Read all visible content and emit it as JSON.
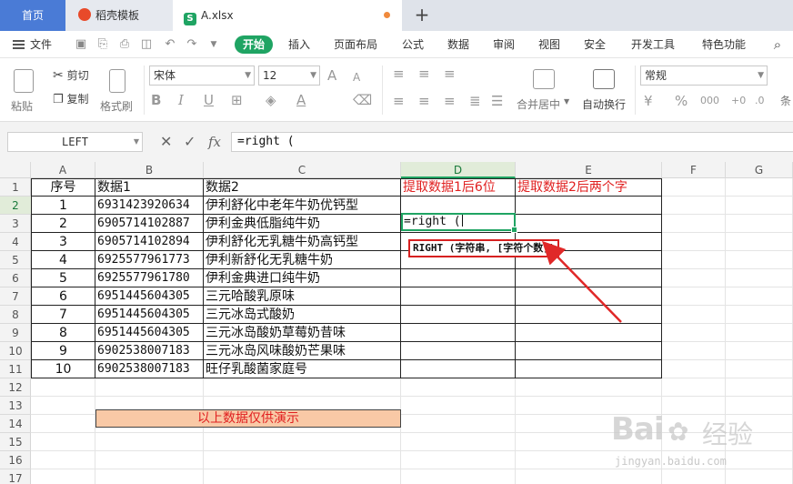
{
  "tabs": {
    "home": "首页",
    "templates": "稻壳模板",
    "file_icon": "S",
    "file": "A.xlsx",
    "add": "+"
  },
  "menu": {
    "file": "文件",
    "start": "开始",
    "items": [
      "插入",
      "页面布局",
      "公式",
      "数据",
      "审阅",
      "视图",
      "安全",
      "开发工具",
      "特色功能"
    ]
  },
  "ribbon": {
    "paste": "粘贴",
    "cut": "剪切",
    "copy": "复制",
    "format_painter": "格式刷",
    "font_name": "宋体",
    "font_size": "12",
    "bold": "B",
    "italic": "I",
    "underline": "U",
    "grow_font": "A",
    "shrink_font": "A",
    "merge_center": "合并居中",
    "wrap_text": "自动换行",
    "number_format": "常规",
    "percent": "%",
    "more": "条"
  },
  "formula_bar": {
    "name_box": "LEFT",
    "cancel": "✕",
    "confirm": "✓",
    "fx": "fx",
    "formula": "=right ("
  },
  "columns": [
    "A",
    "B",
    "C",
    "D",
    "E",
    "F",
    "G"
  ],
  "rows": [
    "1",
    "2",
    "3",
    "4",
    "5",
    "6",
    "7",
    "8",
    "9",
    "10",
    "11",
    "12",
    "13",
    "14",
    "15",
    "16",
    "17"
  ],
  "header_row": {
    "a": "序号",
    "b": "数据1",
    "c": "数据2",
    "d": "提取数据1后6位",
    "e": "提取数据2后两个字"
  },
  "table": [
    {
      "seq": "1",
      "code": "6931423920634",
      "name": "伊利舒化中老年牛奶优钙型"
    },
    {
      "seq": "2",
      "code": "6905714102887",
      "name": "伊利金典低脂纯牛奶"
    },
    {
      "seq": "3",
      "code": "6905714102894",
      "name": "伊利舒化无乳糖牛奶高钙型"
    },
    {
      "seq": "4",
      "code": "6925577961773",
      "name": "伊利新舒化无乳糖牛奶"
    },
    {
      "seq": "5",
      "code": "6925577961780",
      "name": "伊利金典进口纯牛奶"
    },
    {
      "seq": "6",
      "code": "6951445604305",
      "name": "三元哈酸乳原味"
    },
    {
      "seq": "7",
      "code": "6951445604305",
      "name": "三元冰岛式酸奶"
    },
    {
      "seq": "8",
      "code": "6951445604305",
      "name": "三元冰岛酸奶草莓奶昔味"
    },
    {
      "seq": "9",
      "code": "6902538007183",
      "name": "三元冰岛风味酸奶芒果味"
    },
    {
      "seq": "10",
      "code": "6902538007183",
      "name": "旺仔乳酸菌家庭号"
    }
  ],
  "active_cell_text": "=right (",
  "tooltip": "RIGHT (字符串, [字符个数])",
  "note": "以上数据仅供演示",
  "watermark": {
    "brand": "Bai",
    "brand2": "经验",
    "url": "jingyan.baidu.com"
  },
  "colors": {
    "accent": "#1fa463",
    "home_tab": "#4a7bd6",
    "red": "#e02020",
    "note_bg": "#f9c9a6"
  }
}
